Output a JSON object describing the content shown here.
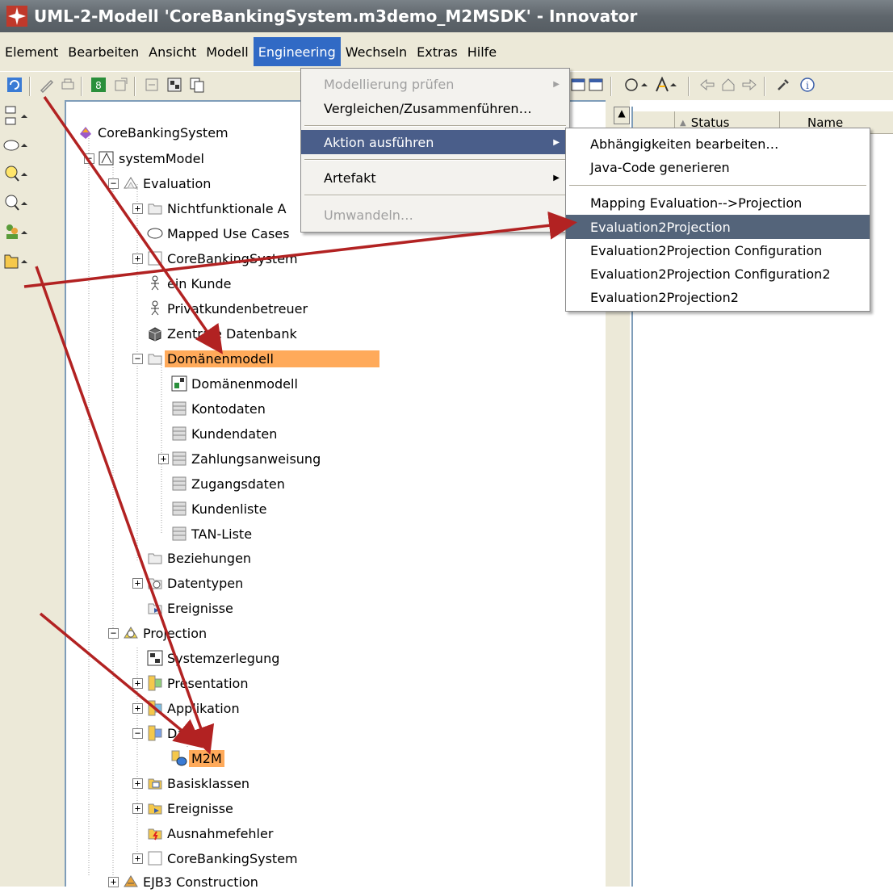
{
  "window": {
    "title": "UML-2-Modell 'CoreBankingSystem.m3demo_M2MSDK' - Innovator"
  },
  "menubar": {
    "items": [
      "Element",
      "Bearbeiten",
      "Ansicht",
      "Modell",
      "Engineering",
      "Wechseln",
      "Extras",
      "Hilfe"
    ],
    "active": "Engineering"
  },
  "engineering_menu": {
    "items": [
      {
        "label": "Modellierung prüfen",
        "disabled": true,
        "submenu": true
      },
      {
        "label": "Vergleichen/Zusammenführen…",
        "disabled": false
      },
      {
        "label": "Aktion ausführen",
        "highlighted": true,
        "submenu": true
      },
      {
        "label": "Artefakt",
        "submenu": true
      },
      {
        "label": "Umwandeln…",
        "disabled": true
      }
    ]
  },
  "action_submenu": {
    "items": [
      {
        "label": "Abhängigkeiten bearbeiten…"
      },
      {
        "label": "Java-Code generieren"
      },
      {
        "label": "Mapping Evaluation-->Projection"
      },
      {
        "label": "Evaluation2Projection",
        "highlighted": true
      },
      {
        "label": "Evaluation2Projection Configuration"
      },
      {
        "label": "Evaluation2Projection Configuration2"
      },
      {
        "label": "Evaluation2Projection2"
      }
    ]
  },
  "columns": {
    "status": "Status",
    "name": "Name"
  },
  "tree": {
    "root": "CoreBankingSystem",
    "system_model": "systemModel",
    "evaluation": "Evaluation",
    "nichtfunktionale": "Nichtfunktionale A",
    "mapped_use_cases": "Mapped Use Cases",
    "core_banking_1": "CoreBankingSystem",
    "ein_kunde": "ein Kunde",
    "privatkunden": "Privatkundenbetreuer",
    "zentrale_db": "Zentrale Datenbank",
    "domaenenmodell_pkg": "Domänenmodell",
    "domaenenmodell_diag": "Domänenmodell",
    "kontodaten": "Kontodaten",
    "kundendaten": "Kundendaten",
    "zahlungsanweisung": "Zahlungsanweisung",
    "zugangsdaten": "Zugangsdaten",
    "kundenliste": "Kundenliste",
    "tan_liste": "TAN-Liste",
    "beziehungen": "Beziehungen",
    "datentypen": "Datentypen",
    "ereignisse_1": "Ereignisse",
    "projection": "Projection",
    "systemzerlegung": "Systemzerlegung",
    "presentation": "Presentation",
    "applikation": "Applikation",
    "daten": "Daten",
    "m2m": "M2M",
    "basisklassen": "Basisklassen",
    "ereignisse_2": "Ereignisse",
    "ausnahmefehler": "Ausnahmefehler",
    "core_banking_2": "CoreBankingSystem",
    "ejb3": "EJB3 Construction"
  },
  "colors": {
    "selection": "#ffaa5a",
    "menu_highlight": "#4a5e8a",
    "annotation_arrow": "#b22222"
  }
}
